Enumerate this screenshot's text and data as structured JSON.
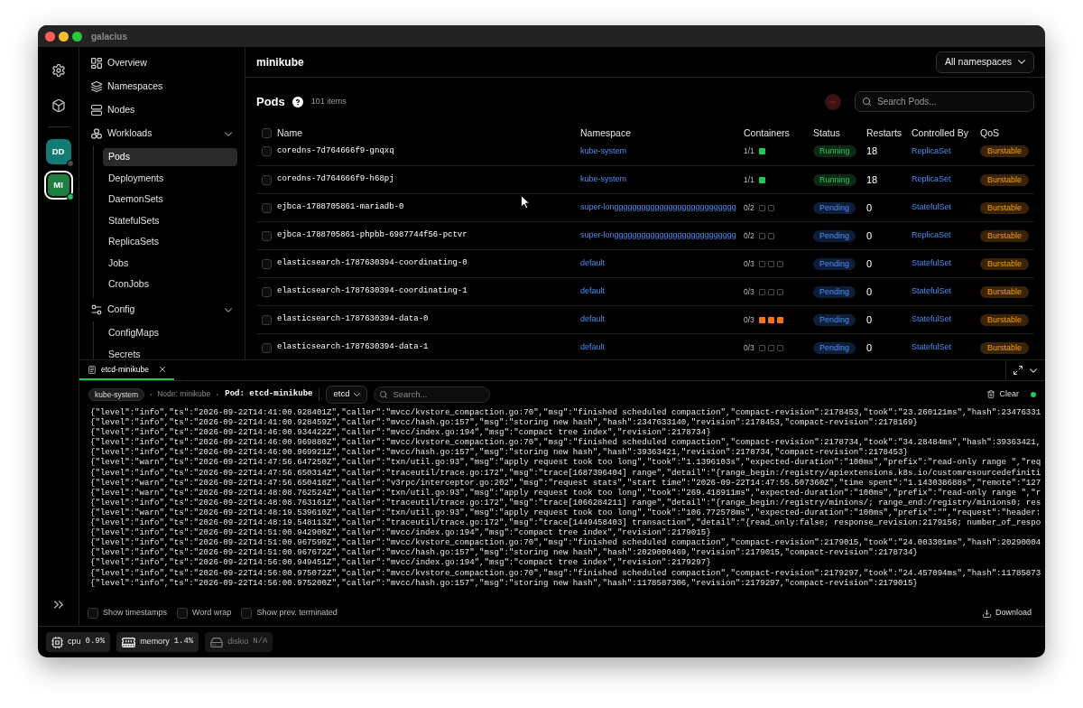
{
  "window": {
    "title": "galacius"
  },
  "rail": {
    "clusters": [
      {
        "label": "DD",
        "color": "#137a74",
        "connected": false,
        "selected": false
      },
      {
        "label": "MI",
        "color": "#1c7f40",
        "connected": true,
        "selected": true
      }
    ]
  },
  "sidebar": {
    "items": [
      {
        "label": "Overview",
        "selected": false
      },
      {
        "label": "Namespaces",
        "selected": false
      },
      {
        "label": "Nodes",
        "selected": false
      },
      {
        "label": "Workloads",
        "selected": false,
        "expanded": true,
        "children": [
          {
            "label": "Pods",
            "selected": true
          },
          {
            "label": "Deployments",
            "selected": false
          },
          {
            "label": "DaemonSets",
            "selected": false
          },
          {
            "label": "StatefulSets",
            "selected": false
          },
          {
            "label": "ReplicaSets",
            "selected": false
          },
          {
            "label": "Jobs",
            "selected": false
          },
          {
            "label": "CronJobs",
            "selected": false
          }
        ]
      },
      {
        "label": "Config",
        "selected": false,
        "expanded": true,
        "children": [
          {
            "label": "ConfigMaps",
            "selected": false
          },
          {
            "label": "Secrets",
            "selected": false
          }
        ]
      }
    ]
  },
  "header": {
    "cluster": "minikube",
    "namespace_filter": "All namespaces"
  },
  "pods": {
    "title": "Pods",
    "count": "101 items",
    "delete_button": {
      "disabled": true
    },
    "search": {
      "placeholder": "Search Pods..."
    },
    "select_all": {
      "checked": false
    },
    "columns": [
      "Name",
      "Namespace",
      "Containers",
      "Status",
      "Restarts",
      "Controlled By",
      "QoS"
    ],
    "rows": [
      {
        "checked": false,
        "name": "coredns-7d764666f9-gnqxq",
        "namespace": "kube-system",
        "ready": "1/1",
        "containers": [
          {
            "kind": "running"
          }
        ],
        "status": {
          "label": "Running",
          "kind": "running"
        },
        "restarts": "18",
        "controlled_by": "ReplicaSet",
        "qos": "Burstable"
      },
      {
        "checked": false,
        "name": "coredns-7d764666f9-h68pj",
        "namespace": "kube-system",
        "ready": "1/1",
        "containers": [
          {
            "kind": "running"
          }
        ],
        "status": {
          "label": "Running",
          "kind": "running"
        },
        "restarts": "18",
        "controlled_by": "ReplicaSet",
        "qos": "Burstable"
      },
      {
        "checked": false,
        "name": "ejbca-1788705861-mariadb-0",
        "namespace": "super-longgggggggggggggggggggggggggg",
        "ready": "0/2",
        "containers": [
          {
            "kind": "empty"
          },
          {
            "kind": "empty"
          }
        ],
        "status": {
          "label": "Pending",
          "kind": "pending"
        },
        "restarts": "0",
        "controlled_by": "StatefulSet",
        "qos": "Burstable"
      },
      {
        "checked": false,
        "name": "ejbca-1788705861-phpbb-6987744f56-pctvr",
        "namespace": "super-longgggggggggggggggggggggggggg",
        "ready": "0/2",
        "containers": [
          {
            "kind": "empty"
          },
          {
            "kind": "empty"
          }
        ],
        "status": {
          "label": "Pending",
          "kind": "pending"
        },
        "restarts": "0",
        "controlled_by": "ReplicaSet",
        "qos": "Burstable"
      },
      {
        "checked": false,
        "name": "elasticsearch-1787630394-coordinating-0",
        "namespace": "default",
        "ready": "0/3",
        "containers": [
          {
            "kind": "empty"
          },
          {
            "kind": "empty"
          },
          {
            "kind": "empty"
          }
        ],
        "status": {
          "label": "Pending",
          "kind": "pending"
        },
        "restarts": "0",
        "controlled_by": "StatefulSet",
        "qos": "Burstable"
      },
      {
        "checked": false,
        "name": "elasticsearch-1787630394-coordinating-1",
        "namespace": "default",
        "ready": "0/3",
        "containers": [
          {
            "kind": "empty"
          },
          {
            "kind": "empty"
          },
          {
            "kind": "empty"
          }
        ],
        "status": {
          "label": "Pending",
          "kind": "pending"
        },
        "restarts": "0",
        "controlled_by": "StatefulSet",
        "qos": "Burstable"
      },
      {
        "checked": false,
        "name": "elasticsearch-1787630394-data-0",
        "namespace": "default",
        "ready": "0/3",
        "containers": [
          {
            "kind": "waiting"
          },
          {
            "kind": "waiting"
          },
          {
            "kind": "waiting"
          }
        ],
        "status": {
          "label": "Pending",
          "kind": "pending"
        },
        "restarts": "0",
        "controlled_by": "StatefulSet",
        "qos": "Burstable"
      },
      {
        "checked": false,
        "name": "elasticsearch-1787630394-data-1",
        "namespace": "default",
        "ready": "0/3",
        "containers": [
          {
            "kind": "empty"
          },
          {
            "kind": "empty"
          },
          {
            "kind": "empty"
          }
        ],
        "status": {
          "label": "Pending",
          "kind": "pending"
        },
        "restarts": "0",
        "controlled_by": "StatefulSet",
        "qos": "Burstable"
      }
    ]
  },
  "logs": {
    "tabs": [
      {
        "label": "etcd-minikube",
        "selected": true
      }
    ],
    "namespace": "kube-system",
    "node": "Node: minikube",
    "pod": "Pod: etcd-minikube",
    "container": "etcd",
    "search": {
      "placeholder": "Search..."
    },
    "clear": "Clear",
    "live": true,
    "lines": [
      "{\"level\":\"info\",\"ts\":\"2026-09-22T14:41:00.928401Z\",\"caller\":\"mvcc/kvstore_compaction.go:70\",\"msg\":\"finished scheduled compaction\",\"compact-revision\":2178453,\"took\":\"23.260121ms\",\"hash\":23476331",
      "{\"level\":\"info\",\"ts\":\"2026-09-22T14:41:00.928459Z\",\"caller\":\"mvcc/hash.go:157\",\"msg\":\"storing new hash\",\"hash\":2347633140,\"revision\":2178453,\"compact-revision\":2178169}",
      "{\"level\":\"info\",\"ts\":\"2026-09-22T14:46:00.934422Z\",\"caller\":\"mvcc/index.go:194\",\"msg\":\"compact tree index\",\"revision\":2178734}",
      "{\"level\":\"info\",\"ts\":\"2026-09-22T14:46:00.969880Z\",\"caller\":\"mvcc/kvstore_compaction.go:70\",\"msg\":\"finished scheduled compaction\",\"compact-revision\":2178734,\"took\":\"34.28484ms\",\"hash\":39363421,",
      "{\"level\":\"info\",\"ts\":\"2026-09-22T14:46:00.969921Z\",\"caller\":\"mvcc/hash.go:157\",\"msg\":\"storing new hash\",\"hash\":39363421,\"revision\":2178734,\"compact-revision\":2178453}",
      "{\"level\":\"warn\",\"ts\":\"2026-09-22T14:47:56.647250Z\",\"caller\":\"txn/util.go:93\",\"msg\":\"apply request took too long\",\"took\":\"1.1396103s\",\"expected-duration\":\"100ms\",\"prefix\":\"read-only range \",\"req",
      "{\"level\":\"info\",\"ts\":\"2026-09-22T14:47:56.650314Z\",\"caller\":\"traceutil/trace.go:172\",\"msg\":\"trace[1687396404] range\",\"detail\":\"{range_begin:/registry/apiextensions.k8s.io/customresourcedefiniti",
      "{\"level\":\"warn\",\"ts\":\"2026-09-22T14:47:56.650418Z\",\"caller\":\"v3rpc/interceptor.go:202\",\"msg\":\"request stats\",\"start time\":\"2026-09-22T14:47:55.507360Z\",\"time spent\":\"1.143038688s\",\"remote\":\"127",
      "{\"level\":\"warn\",\"ts\":\"2026-09-22T14:48:08.762524Z\",\"caller\":\"txn/util.go:93\",\"msg\":\"apply request took too long\",\"took\":\"269.418911ms\",\"expected-duration\":\"100ms\",\"prefix\":\"read-only range \",\"r",
      "{\"level\":\"info\",\"ts\":\"2026-09-22T14:48:08.763161Z\",\"caller\":\"traceutil/trace.go:172\",\"msg\":\"trace[1066284211] range\",\"detail\":\"{range_begin:/registry/minions/; range_end:/registry/minions0; res",
      "{\"level\":\"warn\",\"ts\":\"2026-09-22T14:48:19.539610Z\",\"caller\":\"txn/util.go:93\",\"msg\":\"apply request took too long\",\"took\":\"106.772578ms\",\"expected-duration\":\"100ms\",\"prefix\":\"\",\"request\":\"header:",
      "{\"level\":\"info\",\"ts\":\"2026-09-22T14:48:19.548113Z\",\"caller\":\"traceutil/trace.go:172\",\"msg\":\"trace[1449458403] transaction\",\"detail\":\"{read_only:false; response_revision:2179156; number_of_respo",
      "{\"level\":\"info\",\"ts\":\"2026-09-22T14:51:00.942900Z\",\"caller\":\"mvcc/index.go:194\",\"msg\":\"compact tree index\",\"revision\":2179015}",
      "{\"level\":\"info\",\"ts\":\"2026-09-22T14:51:00.967590Z\",\"caller\":\"mvcc/kvstore_compaction.go:70\",\"msg\":\"finished scheduled compaction\",\"compact-revision\":2179015,\"took\":\"24.003301ms\",\"hash\":20290004",
      "{\"level\":\"info\",\"ts\":\"2026-09-22T14:51:00.967672Z\",\"caller\":\"mvcc/hash.go:157\",\"msg\":\"storing new hash\",\"hash\":2029000469,\"revision\":2179015,\"compact-revision\":2178734}",
      "{\"level\":\"info\",\"ts\":\"2026-09-22T14:56:00.949451Z\",\"caller\":\"mvcc/index.go:194\",\"msg\":\"compact tree index\",\"revision\":2179297}",
      "{\"level\":\"info\",\"ts\":\"2026-09-22T14:56:00.975072Z\",\"caller\":\"mvcc/kvstore_compaction.go:70\",\"msg\":\"finished scheduled compaction\",\"compact-revision\":2179297,\"took\":\"24.457094ms\",\"hash\":11785873",
      "{\"level\":\"info\",\"ts\":\"2026-09-22T14:56:00.975200Z\",\"caller\":\"mvcc/hash.go:157\",\"msg\":\"storing new hash\",\"hash\":1178587306,\"revision\":2179297,\"compact-revision\":2179015}"
    ],
    "options": [
      {
        "label": "Show timestamps",
        "checked": false
      },
      {
        "label": "Word wrap",
        "checked": false
      },
      {
        "label": "Show prev. terminated",
        "checked": false
      }
    ],
    "download": "Download"
  },
  "status_bar": {
    "metrics": [
      {
        "label": "cpu",
        "value": "0.9%",
        "disabled": false
      },
      {
        "label": "memory",
        "value": "1.4%",
        "disabled": false
      },
      {
        "label": "diskio",
        "value": "N/A",
        "disabled": true
      }
    ]
  }
}
